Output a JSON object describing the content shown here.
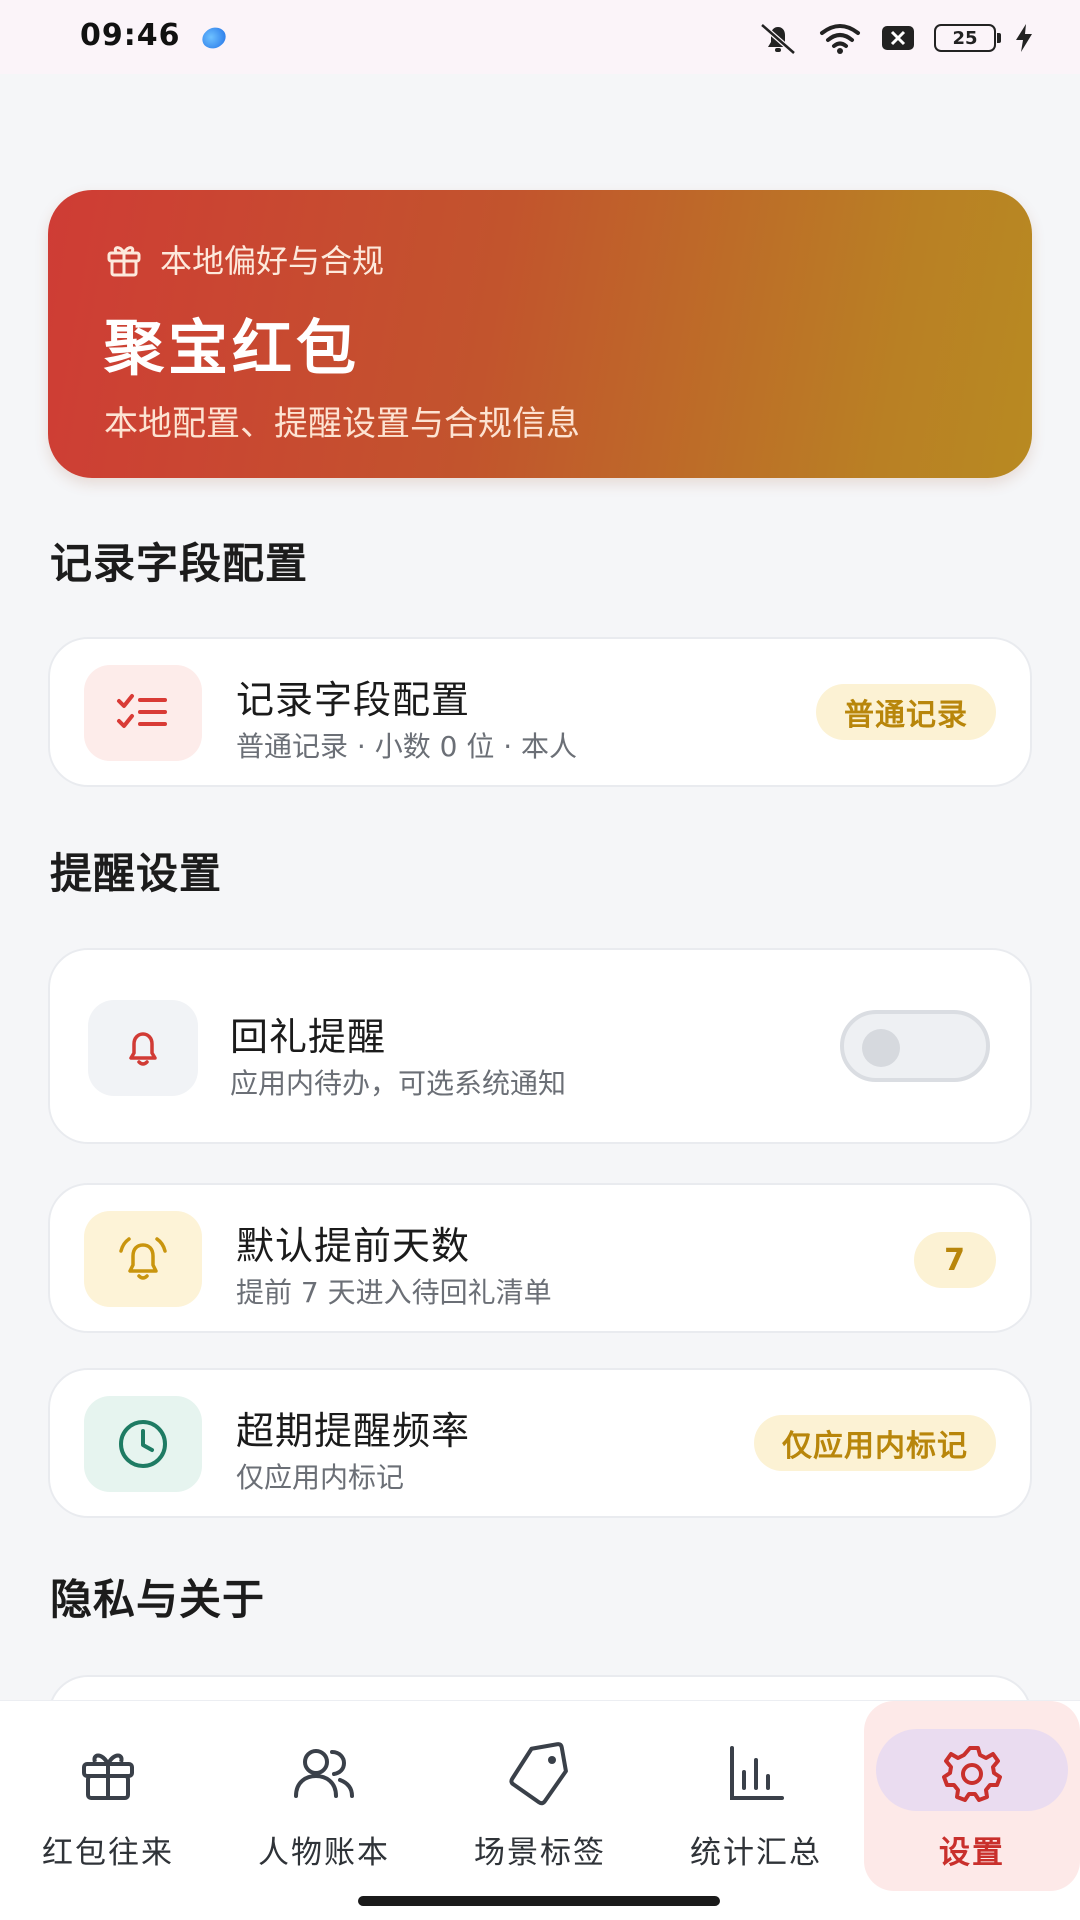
{
  "status_bar": {
    "time": "09:46",
    "battery": "25"
  },
  "hero": {
    "kicker": "本地偏好与合规",
    "title": "聚宝红包",
    "subtitle": "本地配置、提醒设置与合规信息",
    "icon": "gift-icon"
  },
  "sections": {
    "fields": "记录字段配置",
    "reminders": "提醒设置",
    "privacy": "隐私与关于"
  },
  "field_card": {
    "title": "记录字段配置",
    "subtitle": "普通记录 · 小数 0 位 · 本人",
    "badge": "普通记录",
    "icon": "checklist-icon"
  },
  "reminder_card": {
    "title": "回礼提醒",
    "subtitle": "应用内待办，可选系统通知",
    "icon": "bell-icon",
    "toggle_on": false
  },
  "days_card": {
    "title": "默认提前天数",
    "subtitle": "提前 7 天进入待回礼清单",
    "badge": "7",
    "icon": "alarm-icon"
  },
  "overdue_card": {
    "title": "超期提醒频率",
    "subtitle": "仅应用内标记",
    "badge": "仅应用内标记",
    "icon": "clock-icon"
  },
  "nav": {
    "items": [
      {
        "label": "红包往来",
        "icon": "gift-icon"
      },
      {
        "label": "人物账本",
        "icon": "people-icon"
      },
      {
        "label": "场景标签",
        "icon": "tag-icon"
      },
      {
        "label": "统计汇总",
        "icon": "bar-chart-icon"
      },
      {
        "label": "设置",
        "icon": "gear-icon"
      }
    ],
    "active_index": 4
  },
  "colors": {
    "accent_red": "#c9302c",
    "badge_bg": "#fcf2d4",
    "badge_text": "#b8860b",
    "background": "#f5f6f8"
  }
}
